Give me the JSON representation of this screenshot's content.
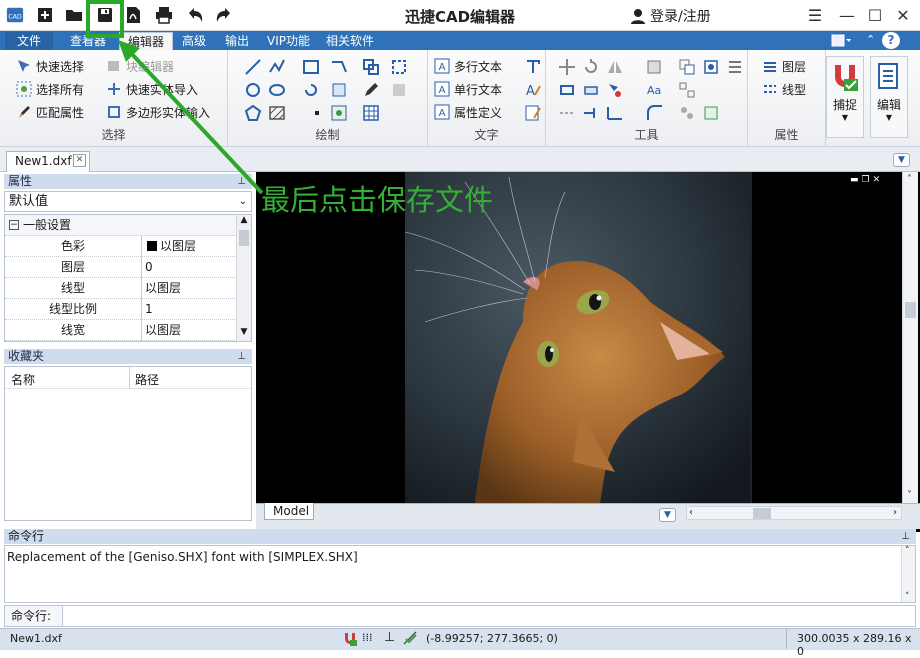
{
  "app": {
    "title": "迅捷CAD编辑器",
    "logo_text": "CAD",
    "login_label": "登录/注册"
  },
  "tabs": [
    {
      "label": "文件"
    },
    {
      "label": "查看器"
    },
    {
      "label": "编辑器"
    },
    {
      "label": "高级"
    },
    {
      "label": "输出"
    },
    {
      "label": "VIP功能"
    },
    {
      "label": "相关软件"
    }
  ],
  "ribbon": {
    "select_group": {
      "label": "选择",
      "items": [
        "快速选择",
        "块编辑器",
        "选择所有",
        "快速实体导入",
        "匹配属性",
        "多边形实体输入"
      ]
    },
    "draw_group": {
      "label": "绘制"
    },
    "text_group": {
      "label": "文字",
      "items": [
        "多行文本",
        "单行文本",
        "属性定义"
      ]
    },
    "tools_group": {
      "label": "工具"
    },
    "props_group": {
      "label": "属性",
      "items": [
        "图层",
        "线型"
      ]
    },
    "snap_label": "捕捉",
    "edit_label": "编辑"
  },
  "document_tab": "New1.dxf",
  "annotation": "最后点击保存文件",
  "properties_panel": {
    "title": "属性",
    "combo_value": "默认值",
    "section": "一般设置",
    "rows": [
      {
        "key": "色彩",
        "value": "以图层"
      },
      {
        "key": "图层",
        "value": "0"
      },
      {
        "key": "线型",
        "value": "以图层"
      },
      {
        "key": "线型比例",
        "value": "1"
      },
      {
        "key": "线宽",
        "value": "以图层"
      }
    ]
  },
  "favorites_panel": {
    "title": "收藏夹",
    "col_name": "名称",
    "col_path": "路径"
  },
  "layout_tab": "Model",
  "command": {
    "title": "命令行",
    "output": "Replacement of the [Geniso.SHX] font with [SIMPLEX.SHX]",
    "prompt": "命令行:"
  },
  "status": {
    "file": "New1.dxf",
    "coords": "(-8.99257; 277.3665; 0)",
    "size": "300.0035 x 289.16 x 0"
  },
  "colors": {
    "accent": "#2f72b9",
    "annotation_green": "#2aa82a"
  }
}
